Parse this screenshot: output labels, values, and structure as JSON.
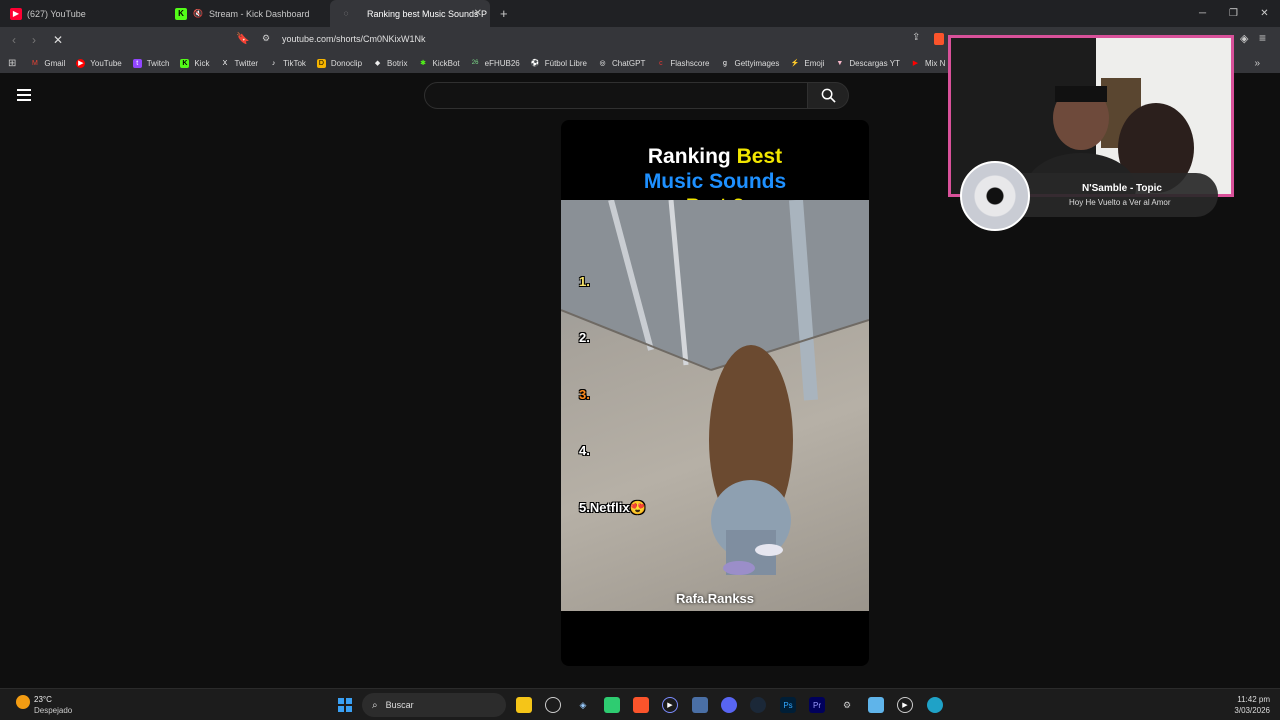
{
  "tabs": [
    {
      "title": "(627) YouTube",
      "color": "#ff0033"
    },
    {
      "title": "Stream - Kick Dashboard",
      "color": "#53fc18"
    },
    {
      "title": "Ranking best Music Sounds P",
      "color": "#888888"
    }
  ],
  "address": {
    "url": "youtube.com/shorts/Cm0NKixW1Nk"
  },
  "bookmarks": [
    {
      "label": "Gmail",
      "icon": "M",
      "color": "#ea4335"
    },
    {
      "label": "YouTube",
      "icon": "▶",
      "color": "#ff0000"
    },
    {
      "label": "Twitch",
      "icon": "t",
      "color": "#9146ff"
    },
    {
      "label": "Kick",
      "icon": "K",
      "color": "#53fc18"
    },
    {
      "label": "Twitter",
      "icon": "X",
      "color": "#000000"
    },
    {
      "label": "TikTok",
      "icon": "♪",
      "color": "#000000"
    },
    {
      "label": "Donoclip",
      "icon": "D",
      "color": "#f5b400"
    },
    {
      "label": "Botrix",
      "icon": "◆",
      "color": "#eeeeee"
    },
    {
      "label": "KickBot",
      "icon": "✱",
      "color": "#53fc18"
    },
    {
      "label": "eFHUB26",
      "icon": "26",
      "color": "#0a7f3f"
    },
    {
      "label": "Fútbol Libre",
      "icon": "⚽",
      "color": "#2e7d32"
    },
    {
      "label": "ChatGPT",
      "icon": "◎",
      "color": "#ffffff"
    },
    {
      "label": "Flashscore",
      "icon": "c",
      "color": "#e53935"
    },
    {
      "label": "Gettyimages",
      "icon": "g",
      "color": "#ffffff"
    },
    {
      "label": "Emoji",
      "icon": "⚡",
      "color": "#ffcc00"
    },
    {
      "label": "Descargas YT",
      "icon": "▼",
      "color": "#f7b6c8"
    },
    {
      "label": "Mix N",
      "icon": "▶",
      "color": "#ff0000"
    }
  ],
  "short": {
    "title_line1_a": "Ranking ",
    "title_line1_b": "Best",
    "title_line2": "Music Sounds",
    "title_line3": "Part 2",
    "ranks": [
      "1.",
      "2.",
      "3.",
      "4.",
      "5.Netflix😍"
    ],
    "watermark": "Rafa.Rankss"
  },
  "music": {
    "artist": "N'Samble - Topic",
    "song": "Hoy He Vuelto a Ver al Amor"
  },
  "taskbar": {
    "temp": "23°C",
    "weather": "Despejado",
    "search": "Buscar",
    "time": "11:42 pm",
    "date": "3/03/2026"
  },
  "colors": {
    "yellow": "#f2e600",
    "blue": "#1e90ff",
    "cam_border": "#d9519a"
  }
}
